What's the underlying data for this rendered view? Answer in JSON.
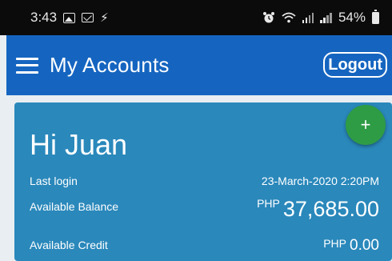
{
  "status_bar": {
    "time": "3:43",
    "battery_percent": "54%",
    "icons": [
      "image-icon",
      "mail-icon",
      "usb-icon",
      "alarm-icon",
      "wifi-icon",
      "signal-icon",
      "signal-icon",
      "battery-icon"
    ]
  },
  "app_bar": {
    "title": "My Accounts",
    "logout_label": "Logout",
    "color": "#1565c0"
  },
  "account": {
    "greeting": "Hi Juan",
    "last_login_label": "Last login",
    "last_login_value": "23-March-2020 2:20PM",
    "balance_label": "Available Balance",
    "balance_currency": "PHP",
    "balance_amount": "37,685.00",
    "credit_label": "Available Credit",
    "credit_currency": "PHP",
    "credit_amount": "0.00",
    "card_color": "#2a88bb"
  },
  "fab": {
    "label": "+",
    "color": "#2e9c45"
  }
}
